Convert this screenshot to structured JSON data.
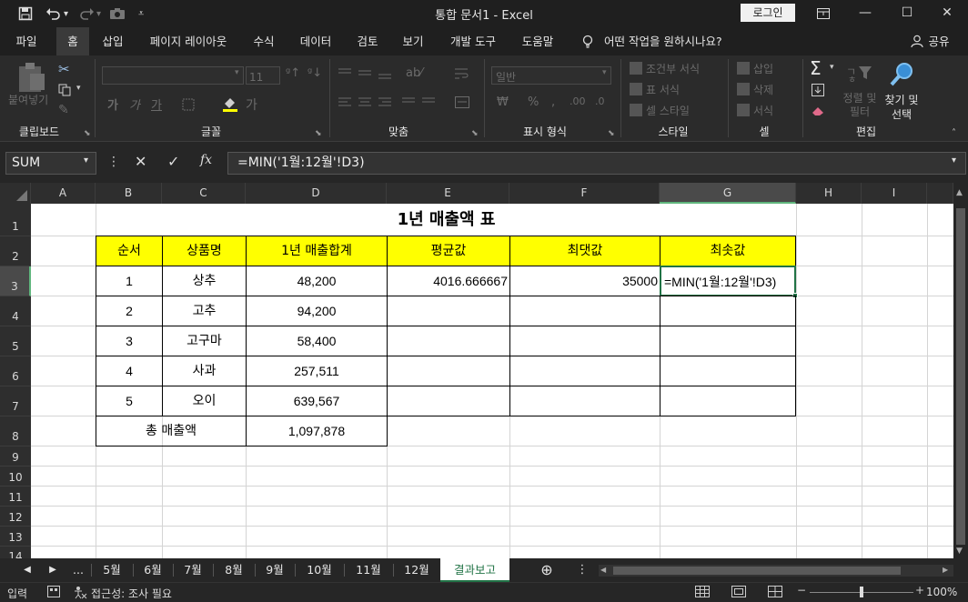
{
  "title_bar": {
    "document_title": "통합 문서1  -  Excel",
    "login_label": "로그인",
    "qat_icons": [
      "save-icon",
      "undo-icon",
      "redo-icon",
      "camera-icon",
      "customize-icon"
    ]
  },
  "ribbon_tabs": [
    "파일",
    "홈",
    "삽입",
    "페이지 레이아웃",
    "수식",
    "데이터",
    "검토",
    "보기",
    "개발 도구",
    "도움말"
  ],
  "active_tab": "홈",
  "tell_me": "어떤 작업을 원하시나요?",
  "share_label": "공유",
  "ribbon": {
    "clipboard": {
      "paste_label": "붙여넣기",
      "group_label": "클립보드"
    },
    "font": {
      "group_label": "글꼴",
      "font_size": "11"
    },
    "alignment": {
      "group_label": "맞춤"
    },
    "number": {
      "format_value": "일반",
      "group_label": "표시 형식"
    },
    "styles": {
      "conditional": "조건부 서식",
      "table": "표 서식",
      "cell_styles": "셀 스타일",
      "group_label": "스타일"
    },
    "cells": {
      "insert": "삽입",
      "delete": "삭제",
      "format": "서식",
      "group_label": "셀"
    },
    "editing": {
      "sort_filter": "정렬 및 필터",
      "find_select_1": "찾기 및",
      "find_select_2": "선택",
      "group_label": "편집"
    }
  },
  "formula_bar": {
    "name_box": "SUM",
    "formula": "=MIN('1월:12월'!D3)"
  },
  "columns": [
    "A",
    "B",
    "C",
    "D",
    "E",
    "F",
    "G",
    "H",
    "I"
  ],
  "rows": [
    "1",
    "2",
    "3",
    "4",
    "5",
    "6",
    "7",
    "8",
    "9",
    "10",
    "11",
    "12",
    "13",
    "14"
  ],
  "sheet": {
    "title": "1년 매출액 표",
    "headers": [
      "순서",
      "상품명",
      "1년 매출합계",
      "평균값",
      "최댓값",
      "최솟값"
    ],
    "data_rows": [
      {
        "seq": "1",
        "name": "상추",
        "total": "48,200",
        "avg": "4016.666667",
        "max": "35000",
        "min": "=MIN('1월:12월'!D3)"
      },
      {
        "seq": "2",
        "name": "고추",
        "total": "94,200",
        "avg": "",
        "max": "",
        "min": ""
      },
      {
        "seq": "3",
        "name": "고구마",
        "total": "58,400",
        "avg": "",
        "max": "",
        "min": ""
      },
      {
        "seq": "4",
        "name": "사과",
        "total": "257,511",
        "avg": "",
        "max": "",
        "min": ""
      },
      {
        "seq": "5",
        "name": "오이",
        "total": "639,567",
        "avg": "",
        "max": "",
        "min": ""
      }
    ],
    "total_label": "총 매출액",
    "total_value": "1,097,878"
  },
  "sheet_tabs": [
    "5월",
    "6월",
    "7월",
    "8월",
    "9월",
    "10월",
    "11월",
    "12월",
    "결과보고"
  ],
  "active_sheet": "결과보고",
  "sheet_nav_ellipsis": "...",
  "status": {
    "mode": "입력",
    "accessibility": "접근성: 조사 필요",
    "zoom": "100%"
  }
}
